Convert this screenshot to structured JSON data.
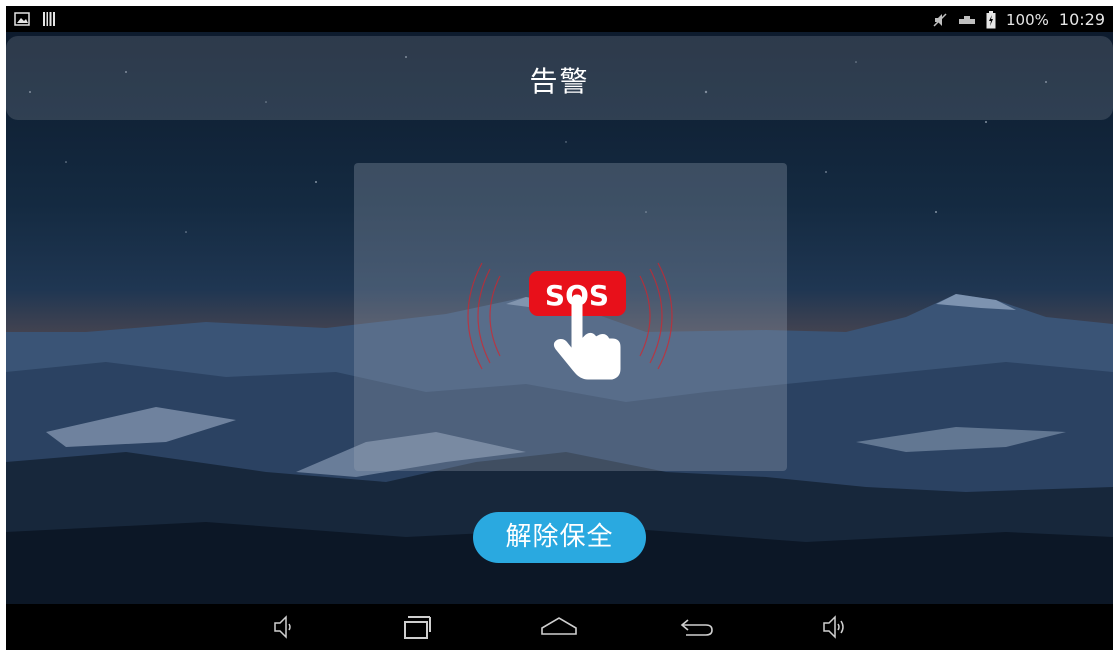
{
  "status_bar": {
    "battery_percent": "100%",
    "time": "10:29",
    "icons": [
      "image-icon",
      "barcode-icon",
      "mute-icon",
      "network-icon",
      "battery-charging-icon"
    ]
  },
  "header": {
    "title": "告警"
  },
  "alarm": {
    "sos_label": "SOS",
    "icon": "sos-press-icon",
    "accent_color": "#e8101a"
  },
  "actions": {
    "disarm_label": "解除保全",
    "button_color": "#2aa9e0"
  },
  "nav_bar": {
    "icons": [
      "volume-down-icon",
      "recent-apps-icon",
      "home-icon",
      "back-icon",
      "volume-up-icon"
    ]
  }
}
